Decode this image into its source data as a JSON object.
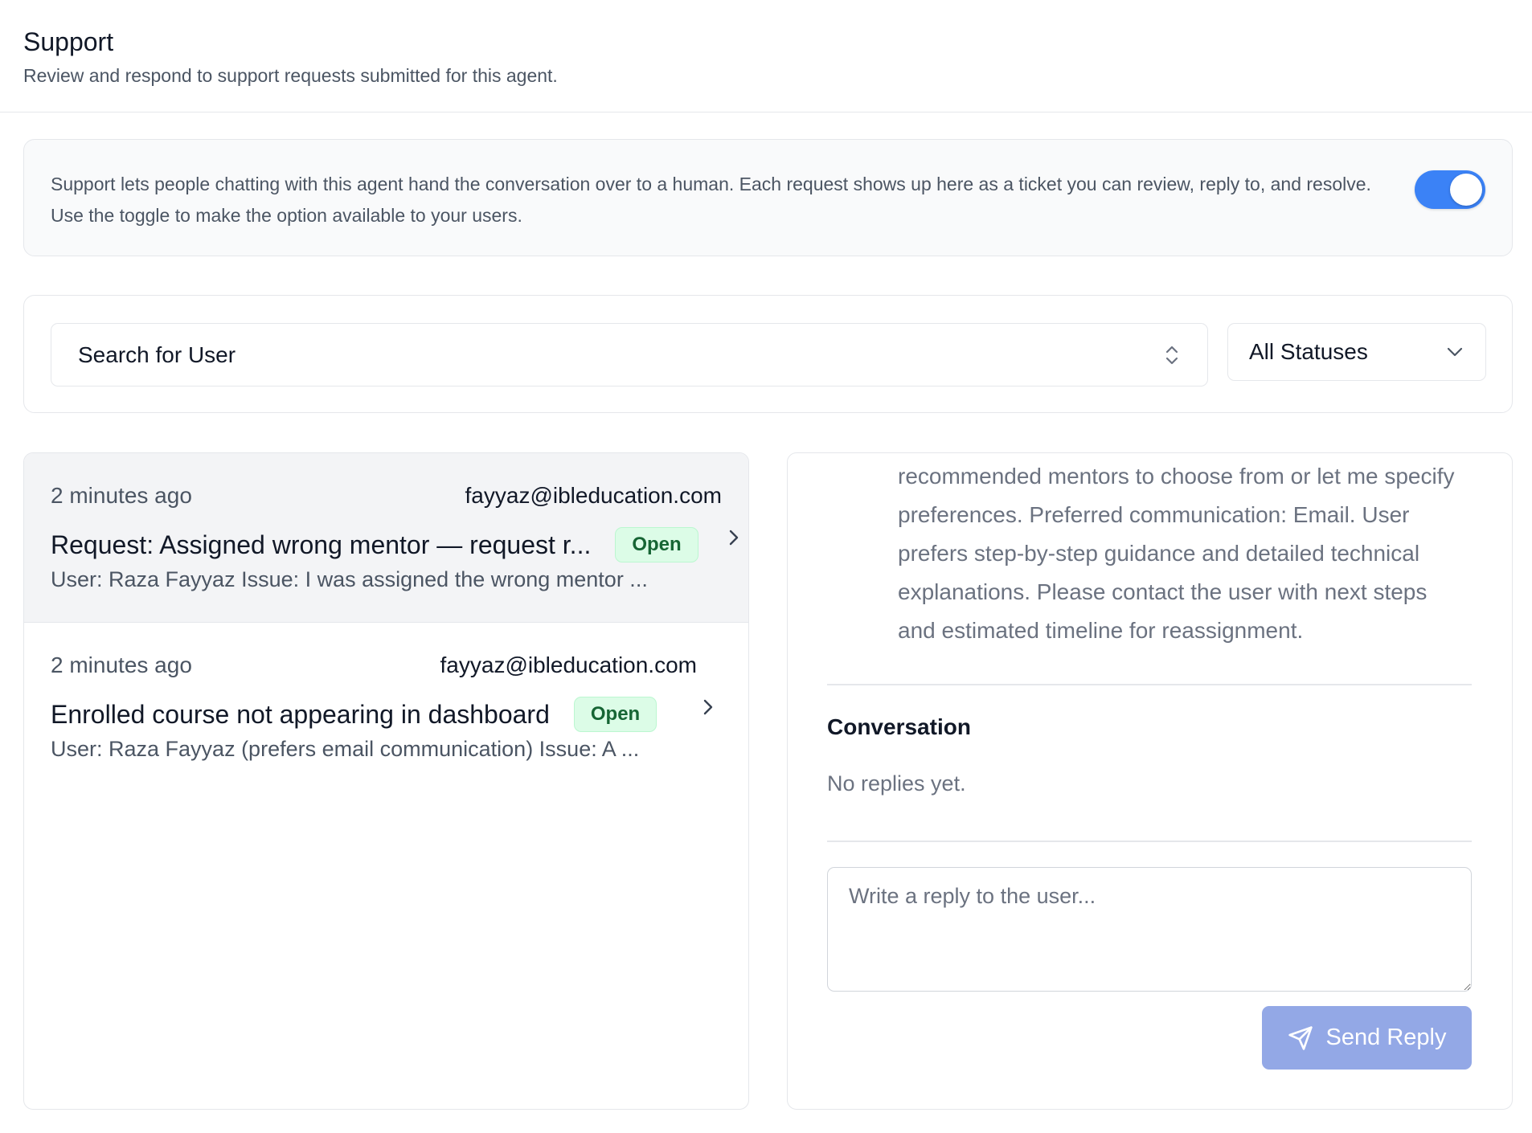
{
  "header": {
    "title": "Support",
    "subtitle": "Review and respond to support requests submitted for this agent."
  },
  "info": {
    "text": "Support lets people chatting with this agent hand the conversation over to a human. Each request shows up here as a ticket you can review, reply to, and resolve. Use the toggle to make the option available to your users.",
    "toggle_on": true,
    "toggle_color": "#3b82f6"
  },
  "filters": {
    "search_label": "Search for User",
    "status_selected": "All Statuses"
  },
  "tickets": [
    {
      "time": "2 minutes ago",
      "email": "fayyaz@ibleducation.com",
      "title": "Request: Assigned wrong mentor — request r...",
      "status": "Open",
      "preview": "User: Raza Fayyaz Issue: I was assigned the wrong mentor ..."
    },
    {
      "time": "2 minutes ago",
      "email": "fayyaz@ibleducation.com",
      "title": "Enrolled course not appearing in dashboard",
      "status": "Open",
      "preview": "User: Raza Fayyaz (prefers email communication) Issue: A ..."
    }
  ],
  "detail": {
    "body": "recommended mentors to choose from or let me specify preferences. Preferred communication: Email. User prefers step-by-step guidance and detailed technical explanations. Please contact the user with next steps and estimated timeline for reassignment.",
    "conversation_heading": "Conversation",
    "conversation_empty": "No replies yet.",
    "reply_placeholder": "Write a reply to the user...",
    "send_label": "Send Reply",
    "send_color": "#93a8e6"
  }
}
